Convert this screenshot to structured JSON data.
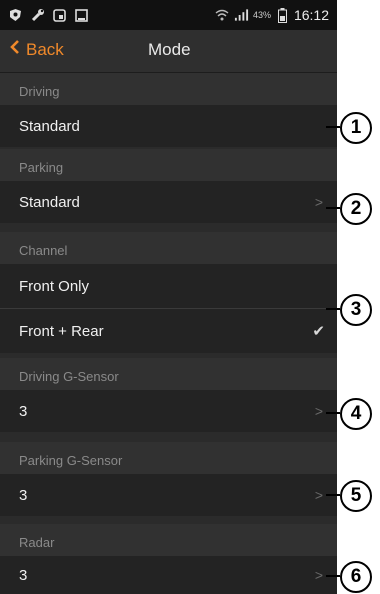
{
  "status_bar": {
    "icons": [
      "shield-icon",
      "wrench-icon",
      "screen-icon",
      "image-icon"
    ],
    "signal_icons": [
      "wifi-icon",
      "signal-icon",
      "battery-icon"
    ],
    "battery_percent": "43%",
    "time": "16:12"
  },
  "header": {
    "back_label": "Back",
    "title": "Mode"
  },
  "sections": {
    "driving": {
      "label": "Driving",
      "value": "Standard"
    },
    "parking": {
      "label": "Parking",
      "value": "Standard"
    },
    "channel": {
      "label": "Channel",
      "option_1": "Front Only",
      "option_2": "Front + Rear",
      "selected": "Front + Rear"
    },
    "driving_gsensor": {
      "label": "Driving G-Sensor",
      "value": "3"
    },
    "parking_gsensor": {
      "label": "Parking G-Sensor",
      "value": "3"
    },
    "radar": {
      "label": "Radar",
      "value": "3"
    }
  },
  "callouts": [
    "1",
    "2",
    "3",
    "4",
    "5",
    "6"
  ],
  "colors": {
    "accent": "#f0892a",
    "background": "#2b2b2b",
    "row": "#232323"
  }
}
